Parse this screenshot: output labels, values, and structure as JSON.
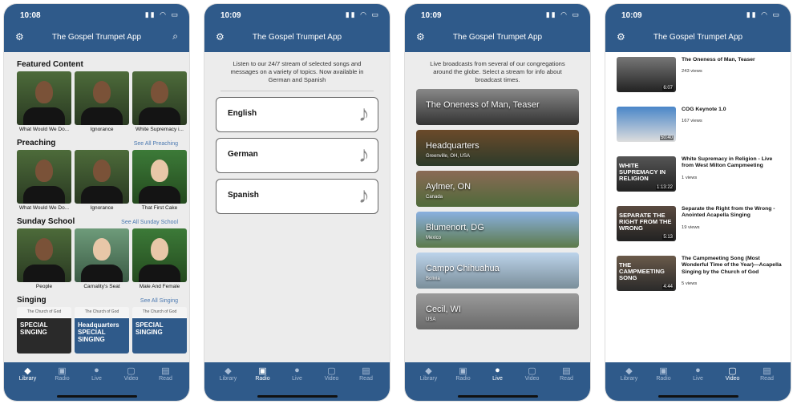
{
  "status_time": "10:08",
  "status_time_2": "10:09",
  "app_title": "The Gospel Trumpet App",
  "tabs": [
    "Library",
    "Radio",
    "Live",
    "Video",
    "Read"
  ],
  "library": {
    "featured": {
      "title": "Featured Content",
      "items": [
        "What Would We Do...",
        "Ignorance",
        "White Supremacy i..."
      ]
    },
    "preaching": {
      "title": "Preaching",
      "see_all": "See All Preaching",
      "items": [
        "What Would We Do...",
        "Ignorance",
        "That First Cake"
      ]
    },
    "sunday": {
      "title": "Sunday School",
      "see_all": "See All Sunday School",
      "items": [
        "People",
        "Carnality's Seat",
        "Male And Female"
      ]
    },
    "singing": {
      "title": "Singing",
      "see_all": "See All Singing",
      "cards": [
        {
          "logo": "The Church of God",
          "text": "SPECIAL SINGING"
        },
        {
          "logo": "The Church of God",
          "text": "Headquarters SPECIAL SINGING"
        },
        {
          "logo": "The Church of God",
          "text": "SPECIAL SINGING"
        }
      ]
    }
  },
  "radio": {
    "description": "Listen to our 24/7 stream of selected songs and messages on a variety of topics. Now available in German and Spanish",
    "languages": [
      "English",
      "German",
      "Spanish"
    ]
  },
  "live": {
    "description": "Live broadcasts from several of our congregations around the globe. Select a stream for info about broadcast times.",
    "streams": [
      {
        "name": "The Oneness of Man, Teaser",
        "loc": ""
      },
      {
        "name": "Headquarters",
        "loc": "Greenville, OH, USA"
      },
      {
        "name": "Aylmer, ON",
        "loc": "Canada"
      },
      {
        "name": "Blumenort, DG",
        "loc": "Mexico"
      },
      {
        "name": "Campo Chihuahua",
        "loc": "Bolivia"
      },
      {
        "name": "Cecil, WI",
        "loc": "USA"
      }
    ]
  },
  "video": {
    "items": [
      {
        "title": "The Oneness of Man, Teaser",
        "views": "243 views",
        "dur": "6:07",
        "thumb_text": ""
      },
      {
        "title": "COG Keynote 1.0",
        "views": "167 views",
        "dur": "50:40",
        "thumb_text": ""
      },
      {
        "title": "White Supremacy in Religion - Live from West Milton Campmeeting",
        "views": "1 views",
        "dur": "1:13:22",
        "thumb_text": "WHITE SUPREMACY IN RELIGION"
      },
      {
        "title": "Separate the Right from the Wrong - Anointed Acapella Singing",
        "views": "19 views",
        "dur": "5:13",
        "thumb_text": "SEPARATE THE RIGHT FROM THE WRONG"
      },
      {
        "title": "The Campmeeting Song (Most Wonderful Time of the Year)—Acapella Singing by the Church of God",
        "views": "5 views",
        "dur": "4:44",
        "thumb_text": "THE CAMPMEETING SONG"
      }
    ]
  },
  "colors": {
    "header": "#2f5a8a",
    "link": "#4a78b0"
  },
  "icons": {
    "settings": "gear-icon",
    "search": "search-icon"
  }
}
